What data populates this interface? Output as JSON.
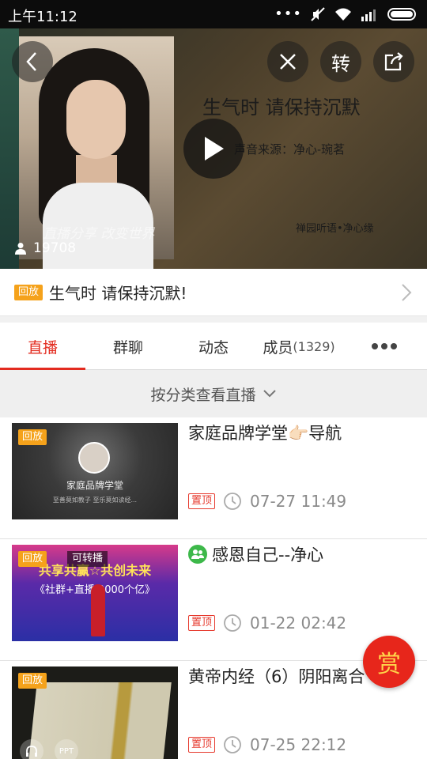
{
  "status_bar": {
    "time": "上午11:12"
  },
  "hero": {
    "title": "生气时 请保持沉默",
    "source": "声音来源：净心-琬茗",
    "small_caption": "禅园听语•净心缘",
    "photo_caption": "直播分享 改变世界",
    "viewer_count": "19708",
    "zhuan_label": "转"
  },
  "title_row": {
    "badge": "回放",
    "title": "生气时 请保持沉默!"
  },
  "tabs": [
    {
      "label": "直播"
    },
    {
      "label": "群聊"
    },
    {
      "label": "动态"
    },
    {
      "label": "成员",
      "count": "(1329)"
    }
  ],
  "filter_label": "按分类查看直播",
  "items": [
    {
      "badge": "回放",
      "title": "家庭品牌学堂👉🏻导航",
      "pin": "置顶",
      "time": "07-27 11:49",
      "thumb_title": "家庭品牌学堂",
      "thumb_sub": "至善莫如教子 至乐莫如读经..."
    },
    {
      "badge": "回放",
      "badge2": "可转播",
      "title": "感恩自己--净心",
      "pin": "置顶",
      "time": "01-22 02:42",
      "thumb_band": "共享共赢☆共创未来",
      "thumb_band2": "《社群+直播 2000个亿》"
    },
    {
      "badge": "回放",
      "title": "黄帝内经（6）阴阳离合",
      "pin": "置顶",
      "time": "07-25 22:12",
      "thumb_ppt": "PPT"
    }
  ],
  "reward_label": "赏",
  "colors": {
    "accent": "#e32b1f",
    "badge": "#f5a21b"
  }
}
